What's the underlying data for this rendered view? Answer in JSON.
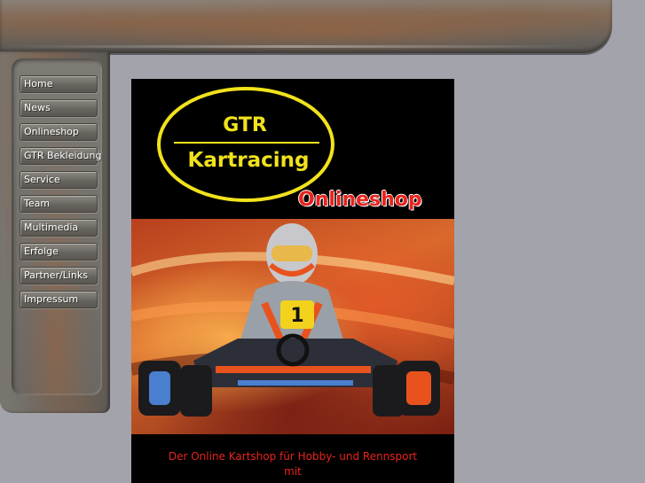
{
  "nav": {
    "items": [
      {
        "label": "Home"
      },
      {
        "label": "News"
      },
      {
        "label": "Onlineshop"
      },
      {
        "label": "GTR Bekleidung"
      },
      {
        "label": "Service"
      },
      {
        "label": "Team"
      },
      {
        "label": "Multimedia"
      },
      {
        "label": "Erfolge"
      },
      {
        "label": "Partner/Links"
      },
      {
        "label": "Impressum"
      }
    ]
  },
  "poster": {
    "logo_line1": "GTR",
    "logo_line2": "Kartracing",
    "logo_sub": "Onlineshop",
    "kart_number": "1",
    "tagline_line1": "Der Online Kartshop für Hobby- und Rennsport",
    "tagline_line2": "mit"
  },
  "colors": {
    "background": "#a3a3ac",
    "logo_yellow": "#f1e21c",
    "accent_red": "#e8231d"
  }
}
